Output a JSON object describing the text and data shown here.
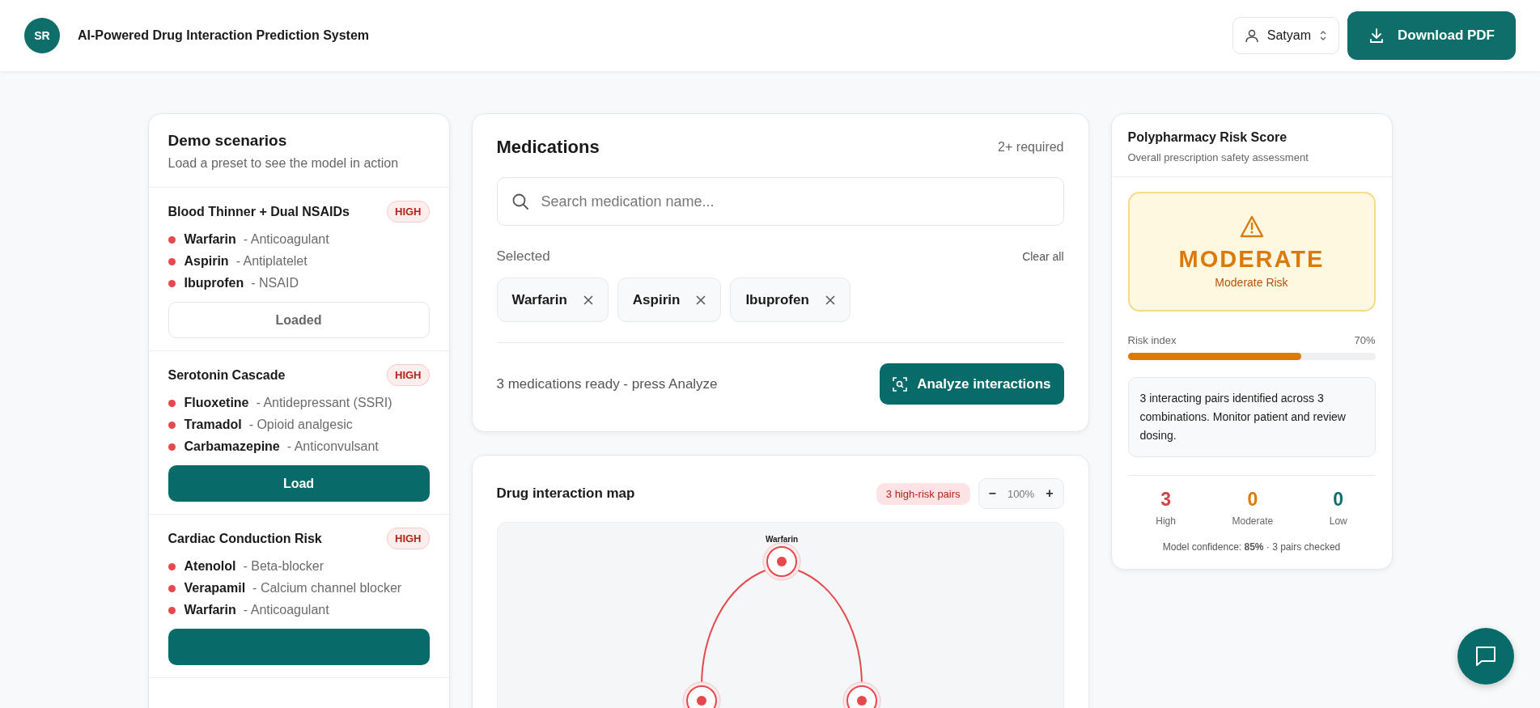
{
  "header": {
    "avatar": "SR",
    "title": "AI-Powered Drug Interaction Prediction System",
    "user": "Satyam",
    "download_button": "Download PDF"
  },
  "scenarios": {
    "title": "Demo scenarios",
    "subtitle": "Load a preset to see the model in action",
    "items": [
      {
        "name": "Blood Thinner + Dual NSAIDs",
        "risk": "HIGH",
        "drugs": [
          {
            "name": "Warfarin",
            "class": "- Anticoagulant"
          },
          {
            "name": "Aspirin",
            "class": "- Antiplatelet"
          },
          {
            "name": "Ibuprofen",
            "class": "- NSAID"
          }
        ],
        "loaded": true,
        "button": "Loaded"
      },
      {
        "name": "Serotonin Cascade",
        "risk": "HIGH",
        "drugs": [
          {
            "name": "Fluoxetine",
            "class": "- Antidepressant (SSRI)"
          },
          {
            "name": "Tramadol",
            "class": "- Opioid analgesic"
          },
          {
            "name": "Carbamazepine",
            "class": "- Anticonvulsant"
          }
        ],
        "loaded": false,
        "button": "Load"
      },
      {
        "name": "Cardiac Conduction Risk",
        "risk": "HIGH",
        "drugs": [
          {
            "name": "Atenolol",
            "class": "- Beta-blocker"
          },
          {
            "name": "Verapamil",
            "class": "- Calcium channel blocker"
          },
          {
            "name": "Warfarin",
            "class": "- Anticoagulant"
          }
        ],
        "loaded": false
      }
    ]
  },
  "medications": {
    "title": "Medications",
    "hint": "2+ required",
    "search": {
      "placeholder": "Search medication name..."
    },
    "selected_label": "Selected",
    "clear_all": "Clear all",
    "chips": [
      "Warfarin",
      "Aspirin",
      "Ibuprofen"
    ],
    "status": "3 medications ready - press Analyze",
    "analyze_button": "Analyze interactions"
  },
  "map": {
    "title": "Drug interaction map",
    "badge": "3 high-risk pairs",
    "zoom_out": "−",
    "zoom": "100%",
    "zoom_in": "+",
    "nodes": [
      {
        "label": "Warfarin"
      }
    ]
  },
  "risk": {
    "title": "Polypharmacy Risk Score",
    "subtitle": "Overall prescription safety assessment",
    "level_text": "MODERATE",
    "level_label": "Moderate Risk",
    "risk_index": {
      "label": "Risk index",
      "reading": "70%",
      "level": 0.7
    },
    "note": "3 interacting pairs identified across 3 combinations. Monitor patient and review dosing.",
    "counts": [
      {
        "value": "3",
        "label": "High",
        "color": "#d1434b"
      },
      {
        "value": "0",
        "label": "Moderate",
        "color": "#d97a0b"
      },
      {
        "value": "0",
        "label": "Low",
        "color": "#0f6e6a"
      }
    ],
    "confidence": "Model confidence: **85%** · 3 pairs checked"
  }
}
